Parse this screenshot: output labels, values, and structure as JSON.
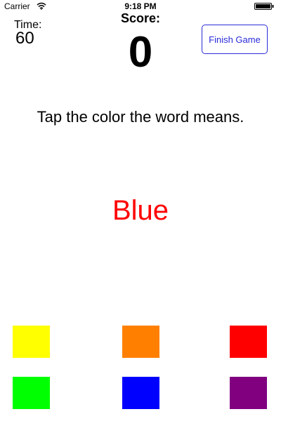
{
  "status_bar": {
    "carrier": "Carrier",
    "time": "9:18 PM",
    "wifi_icon": "wifi-icon",
    "battery_icon": "battery-icon"
  },
  "hud": {
    "time_label": "Time:",
    "time_value": "60",
    "score_label": "Score:",
    "score_value": "0",
    "finish_button_label": "Finish Game"
  },
  "game": {
    "instruction": "Tap the color the word means.",
    "word": "Blue",
    "word_color": "#ff0000",
    "swatches": [
      {
        "name": "yellow",
        "color": "#ffff00"
      },
      {
        "name": "orange",
        "color": "#ff8000"
      },
      {
        "name": "red",
        "color": "#ff0000"
      },
      {
        "name": "green",
        "color": "#00ff00"
      },
      {
        "name": "blue",
        "color": "#0000ff"
      },
      {
        "name": "purple",
        "color": "#800080"
      }
    ]
  },
  "colors": {
    "button_accent": "#2a2ad8"
  }
}
